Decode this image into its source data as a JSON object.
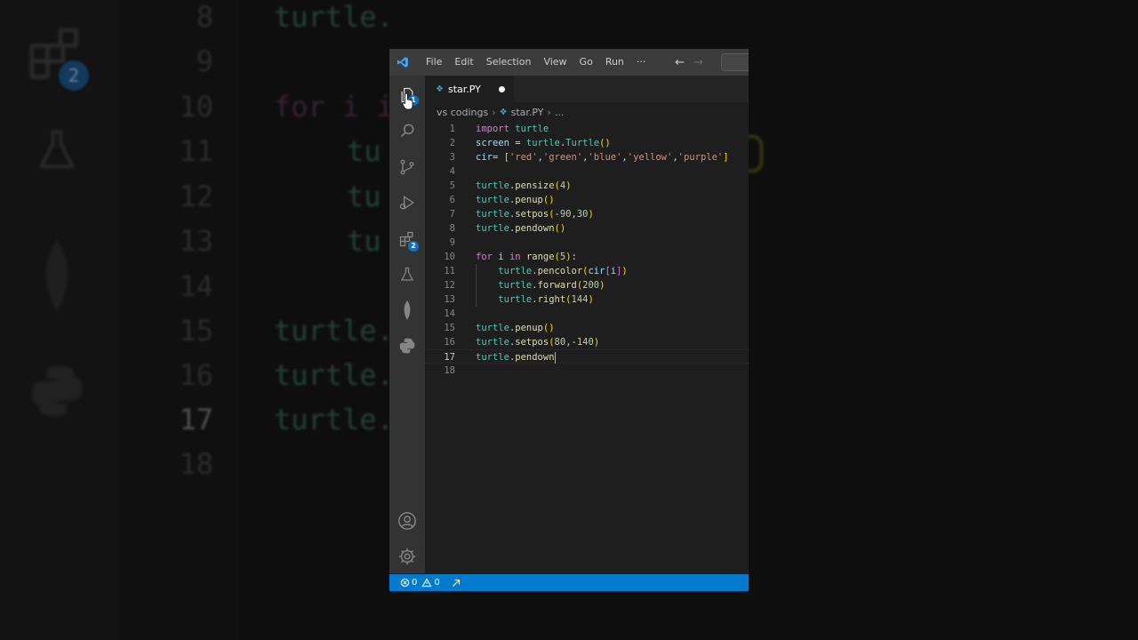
{
  "titlebar": {
    "menu": [
      "File",
      "Edit",
      "Selection",
      "View",
      "Go",
      "Run",
      "···"
    ],
    "back_icon": "arrow-left-icon",
    "forward_icon": "arrow-right-icon"
  },
  "activitybar": {
    "explorer_badge": "1",
    "extensions_badge": "2",
    "icons": [
      "files-icon",
      "search-icon",
      "source-control-icon",
      "run-debug-icon",
      "extensions-icon",
      "testing-icon",
      "mongodb-leaf-icon",
      "python-icon",
      "account-icon",
      "settings-gear-icon"
    ]
  },
  "tab": {
    "filename": "star.PY",
    "modified": true
  },
  "breadcrumb": {
    "folder": "vs codings",
    "file": "star.PY",
    "more": "..."
  },
  "editor": {
    "line_numbers": [
      "1",
      "2",
      "3",
      "4",
      "5",
      "6",
      "7",
      "8",
      "9",
      "10",
      "11",
      "12",
      "13",
      "14",
      "15",
      "16",
      "17",
      "18"
    ],
    "active_line": "17",
    "lines": [
      "import turtle",
      "screen = turtle.Turtle()",
      "cir= ['red','green','blue','yellow','purple']",
      "",
      "turtle.pensize(4)",
      "turtle.penup()",
      "turtle.setpos(-90,30)",
      "turtle.pendown()",
      "",
      "for i in range(5):",
      "    turtle.pencolor(cir[i])",
      "    turtle.forward(200)",
      "    turtle.right(144)",
      "",
      "turtle.penup()",
      "turtle.setpos(80,-140)",
      "turtle.pendown",
      ""
    ]
  },
  "statusbar": {
    "errors": "0",
    "warnings": "0"
  },
  "background": {
    "line_numbers": [
      "8",
      "9",
      "10",
      "11",
      "12",
      "13",
      "14",
      "15",
      "16",
      "17",
      "18"
    ],
    "code_fragments": [
      "turtle.",
      "",
      "for i i",
      "tu",
      "tu",
      "tu",
      "",
      "turtle.",
      "turtle.",
      "turtle.",
      ""
    ],
    "badge": "2"
  },
  "colors": {
    "accent": "#007acc",
    "titlebar": "#3c3c3c",
    "activitybar": "#333333",
    "editor": "#1e1e1e"
  }
}
